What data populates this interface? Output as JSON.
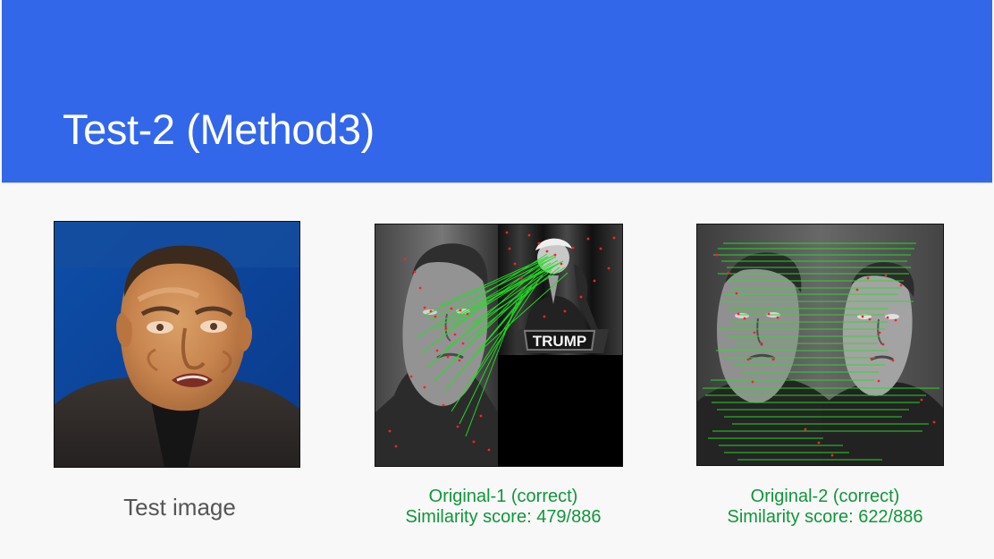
{
  "slide": {
    "title": "Test-2 (Method3)"
  },
  "images": {
    "test": {
      "caption": "Test image"
    },
    "original1": {
      "label_text": "TRUMP",
      "caption_line1": "Original-1 (correct)",
      "caption_line2": "Similarity score: 479/886"
    },
    "original2": {
      "caption_line1": "Original-2 (correct)",
      "caption_line2": "Similarity score: 622/886"
    }
  },
  "colors": {
    "header": "#3367ea",
    "background": "#f8f8f8",
    "caption_green": "#10963a",
    "test_caption": "#555555",
    "match_lines": "#22e022",
    "keypoints": "#ff2222"
  }
}
